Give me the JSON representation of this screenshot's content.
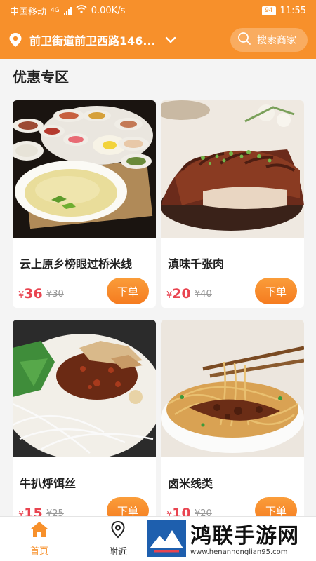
{
  "status_bar": {
    "carrier": "中国移动",
    "net_type": "4G",
    "speed": "0.00K/s",
    "battery": "94",
    "time": "11:55"
  },
  "header": {
    "address": "前卫街道前卫西路146...",
    "search_placeholder": "搜索商家"
  },
  "section": {
    "title": "优惠专区"
  },
  "products": [
    {
      "name": "云上原乡榜眼过桥米线",
      "currency": "¥",
      "price": "36",
      "old_price": "¥30",
      "order_label": "下单"
    },
    {
      "name": "滇味千张肉",
      "currency": "¥",
      "price": "20",
      "old_price": "¥40",
      "order_label": "下单"
    },
    {
      "name": "牛扒烀饵丝",
      "currency": "¥",
      "price": "15",
      "old_price": "¥25",
      "order_label": "下单"
    },
    {
      "name": "卤米线类",
      "currency": "¥",
      "price": "10",
      "old_price": "¥20",
      "order_label": "下单"
    }
  ],
  "tabbar": {
    "home": "首页",
    "nearby": "附近"
  },
  "watermark": {
    "title": "鸿联手游网",
    "url": "www.henanhonglian95.com"
  },
  "colors": {
    "brand": "#f7902b",
    "price": "#e94450"
  }
}
